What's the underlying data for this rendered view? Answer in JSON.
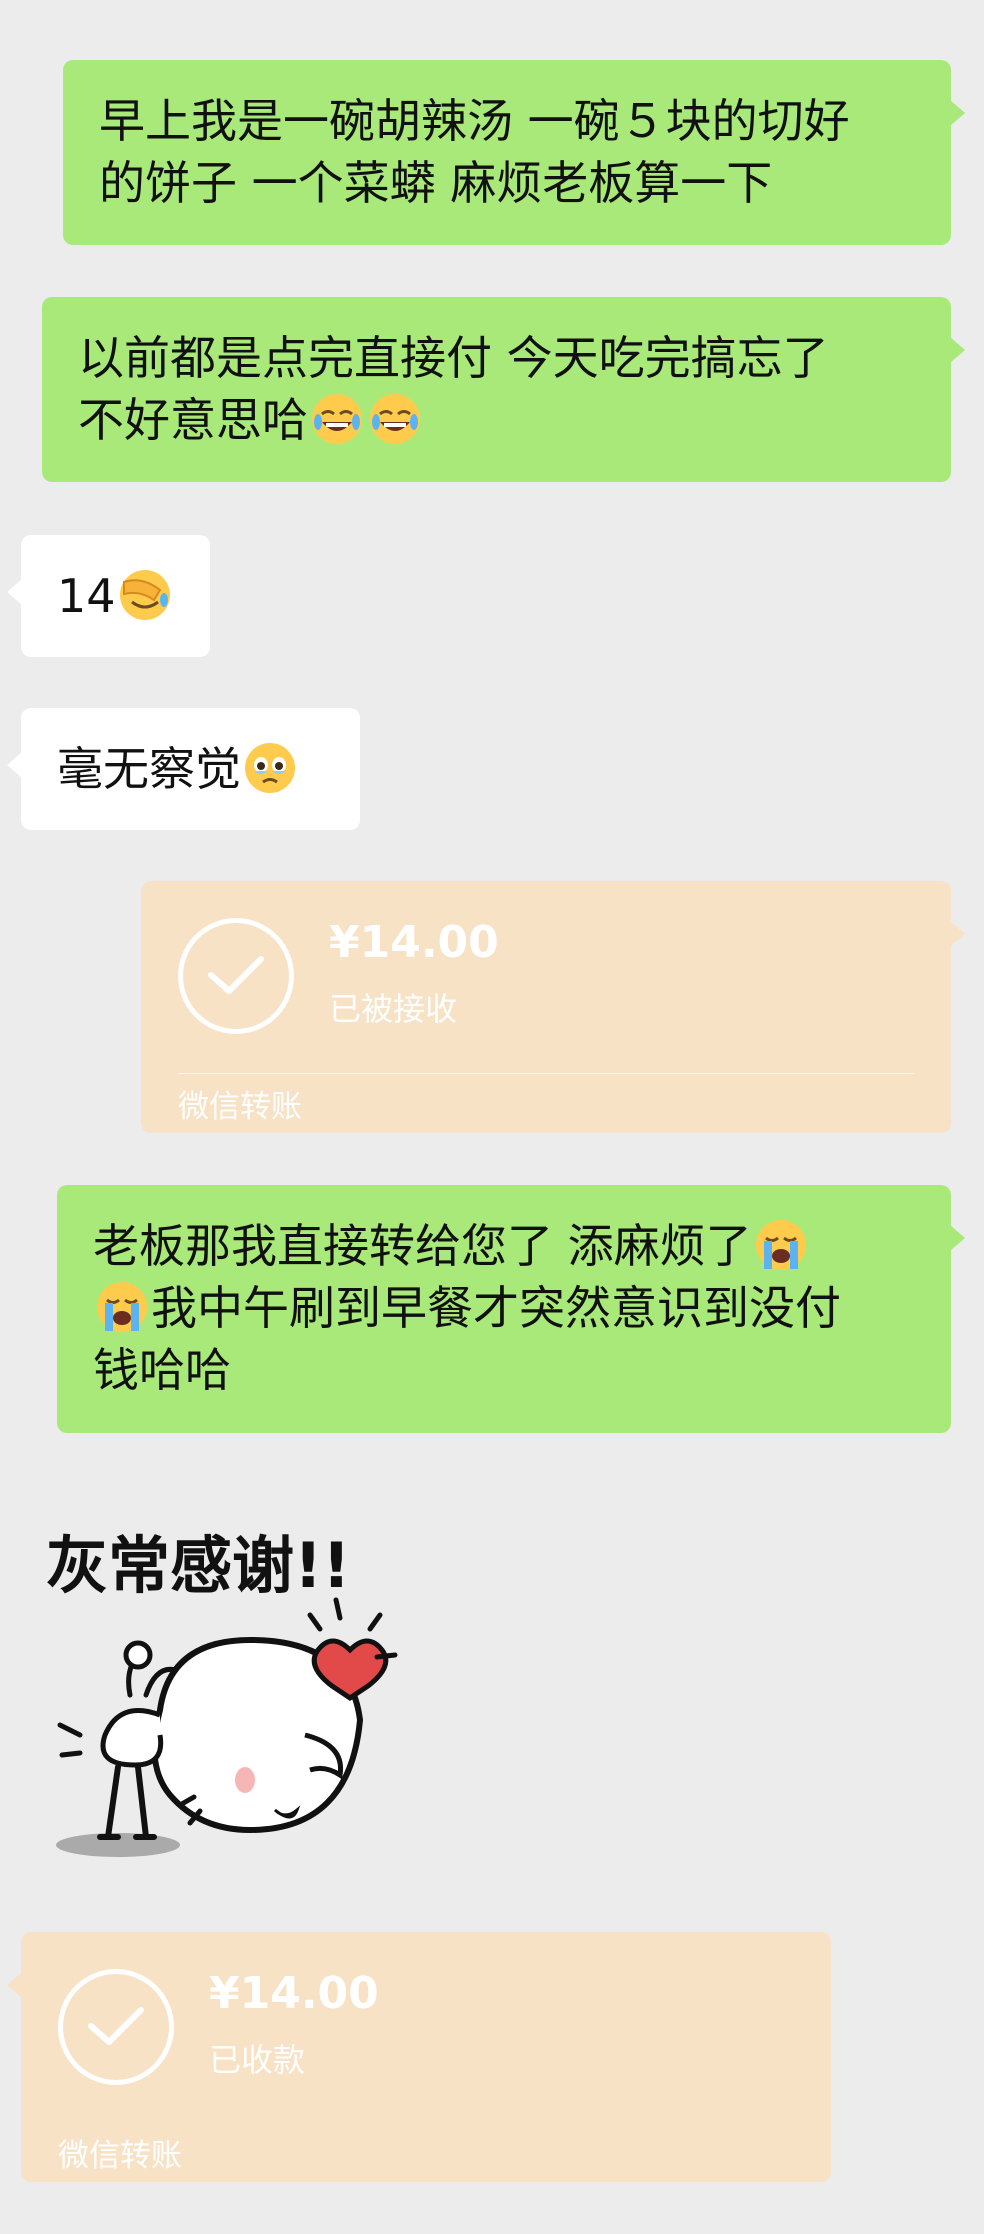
{
  "messages": {
    "m1": {
      "line1": "早上我是一碗胡辣汤 一碗５块的切好",
      "line2": "的饼子 一个菜蟒 麻烦老板算一下"
    },
    "m2": {
      "line1": "以前都是点完直接付 今天吃完搞忘了",
      "line2": "不好意思哈",
      "emoji": "grinning-sweat-face-emoji"
    },
    "m3": {
      "text": "14",
      "emoji": "face-palm-emoji"
    },
    "m4": {
      "text": "毫无察觉",
      "emoji": "holding-back-tears-emoji"
    },
    "m5": {
      "line1": "老板那我直接转给您了 添麻烦了",
      "line2": "我中午刷到早餐才突然意识到没付",
      "line3": "钱哈哈",
      "emoji": "loudly-crying-face-emoji"
    }
  },
  "transfers": {
    "t1": {
      "amount": "¥14.00",
      "status": "已被接收",
      "label": "微信转账",
      "icon": "check-circle-icon"
    },
    "t2": {
      "amount": "¥14.00",
      "status": "已收款",
      "label": "微信转账",
      "icon": "check-circle-icon"
    }
  },
  "sticker": {
    "caption": "灰常感谢!!",
    "icon": "thank-you-bird-sticker"
  },
  "colors": {
    "background": "#ececec",
    "outgoing_bubble": "#a9e97a",
    "incoming_bubble": "#ffffff",
    "transfer_card": "#f8e2c6"
  }
}
